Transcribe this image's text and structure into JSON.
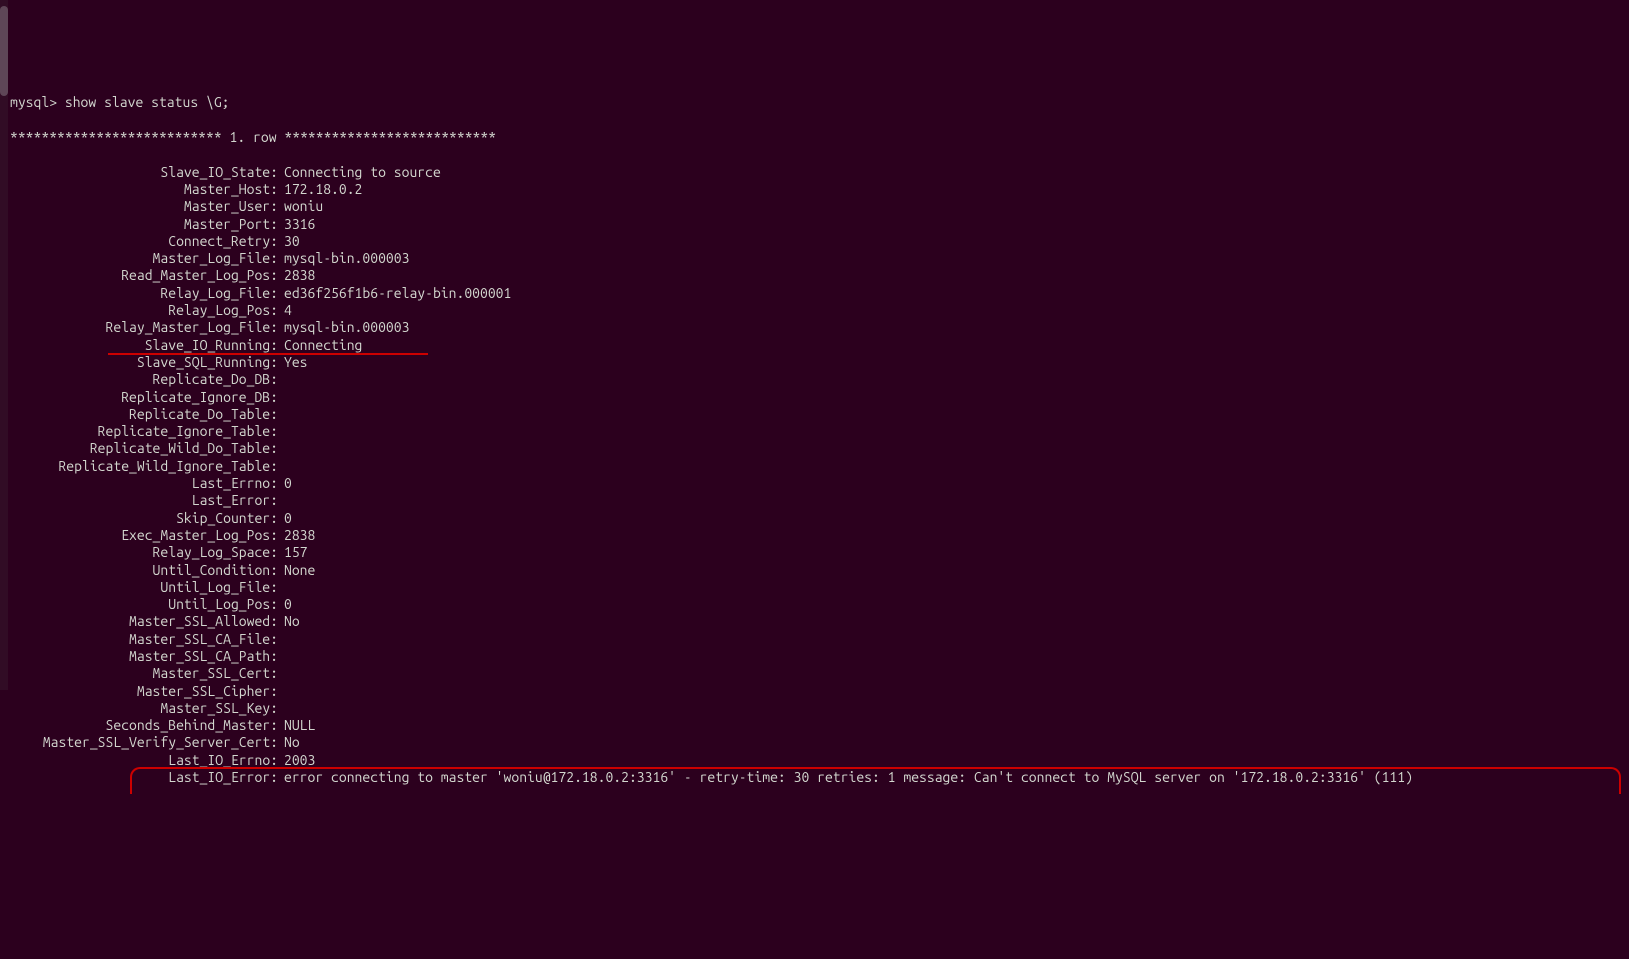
{
  "prompt": "mysql> show slave status \\G;",
  "row_header": "*************************** 1. row ***************************",
  "fields": [
    {
      "label": "Slave_IO_State",
      "value": "Connecting to source"
    },
    {
      "label": "Master_Host",
      "value": "172.18.0.2"
    },
    {
      "label": "Master_User",
      "value": "woniu"
    },
    {
      "label": "Master_Port",
      "value": "3316"
    },
    {
      "label": "Connect_Retry",
      "value": "30"
    },
    {
      "label": "Master_Log_File",
      "value": "mysql-bin.000003"
    },
    {
      "label": "Read_Master_Log_Pos",
      "value": "2838"
    },
    {
      "label": "Relay_Log_File",
      "value": "ed36f256f1b6-relay-bin.000001"
    },
    {
      "label": "Relay_Log_Pos",
      "value": "4"
    },
    {
      "label": "Relay_Master_Log_File",
      "value": "mysql-bin.000003"
    },
    {
      "label": "Slave_IO_Running",
      "value": "Connecting",
      "highlight": "underline"
    },
    {
      "label": "Slave_SQL_Running",
      "value": "Yes"
    },
    {
      "label": "Replicate_Do_DB",
      "value": ""
    },
    {
      "label": "Replicate_Ignore_DB",
      "value": ""
    },
    {
      "label": "Replicate_Do_Table",
      "value": ""
    },
    {
      "label": "Replicate_Ignore_Table",
      "value": ""
    },
    {
      "label": "Replicate_Wild_Do_Table",
      "value": ""
    },
    {
      "label": "Replicate_Wild_Ignore_Table",
      "value": ""
    },
    {
      "label": "Last_Errno",
      "value": "0"
    },
    {
      "label": "Last_Error",
      "value": ""
    },
    {
      "label": "Skip_Counter",
      "value": "0"
    },
    {
      "label": "Exec_Master_Log_Pos",
      "value": "2838"
    },
    {
      "label": "Relay_Log_Space",
      "value": "157"
    },
    {
      "label": "Until_Condition",
      "value": "None"
    },
    {
      "label": "Until_Log_File",
      "value": ""
    },
    {
      "label": "Until_Log_Pos",
      "value": "0"
    },
    {
      "label": "Master_SSL_Allowed",
      "value": "No"
    },
    {
      "label": "Master_SSL_CA_File",
      "value": ""
    },
    {
      "label": "Master_SSL_CA_Path",
      "value": ""
    },
    {
      "label": "Master_SSL_Cert",
      "value": ""
    },
    {
      "label": "Master_SSL_Cipher",
      "value": ""
    },
    {
      "label": "Master_SSL_Key",
      "value": ""
    },
    {
      "label": "Seconds_Behind_Master",
      "value": "NULL"
    },
    {
      "label": "Master_SSL_Verify_Server_Cert",
      "value": "No"
    },
    {
      "label": "Last_IO_Errno",
      "value": "2003"
    },
    {
      "label": "Last_IO_Error",
      "value": "error connecting to master 'woniu@172.18.0.2:3316' - retry-time: 30 retries: 1 message: Can't connect to MySQL server on '172.18.0.2:3316' (111)",
      "highlight": "box"
    }
  ]
}
